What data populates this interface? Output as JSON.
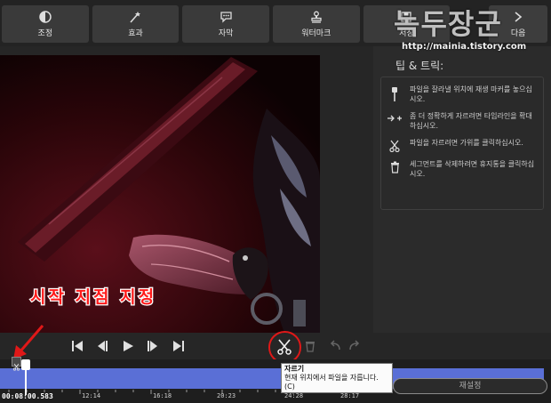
{
  "toolbar": {
    "items": [
      {
        "label": "조정",
        "icon": "adjust-icon"
      },
      {
        "label": "효과",
        "icon": "magic-wand-icon"
      },
      {
        "label": "자막",
        "icon": "subtitle-bubble-icon"
      },
      {
        "label": "워터마크",
        "icon": "stamp-icon"
      },
      {
        "label": "저장",
        "icon": "save-icon"
      },
      {
        "label": "다음",
        "icon": "next-icon"
      }
    ]
  },
  "watermark": {
    "title": "녹두장군",
    "url": "http://mainia.tistory.com"
  },
  "overlay_text": "시작 지점 지정",
  "tips": {
    "title": "팁 & 트릭:",
    "items": [
      {
        "icon": "marker-pin-icon",
        "text": "파일을 잘라낼 위치에 재생 마커를 놓으십시오."
      },
      {
        "icon": "zoom-arrows-icon",
        "text": "좀 더 정확하게 자르려면 타임라인을 확대하십시오."
      },
      {
        "icon": "scissors-icon",
        "text": "파일을 자르려면 가위를 클릭하십시오."
      },
      {
        "icon": "trash-icon",
        "text": "세그먼트를 삭제하려면 휴지통을 클릭하십시오."
      }
    ]
  },
  "tooltip": {
    "title": "자르기",
    "text": "현재 위치에서 파일을 자릅니다. (C)"
  },
  "timeline": {
    "current_time": "00:08:00.583",
    "ticks": [
      "12:14",
      "16:18",
      "20:23",
      "24:28",
      "28:17"
    ],
    "reset_label": "재설정"
  },
  "colors": {
    "accent": "#5a6fd6",
    "highlight": "#e01818"
  }
}
